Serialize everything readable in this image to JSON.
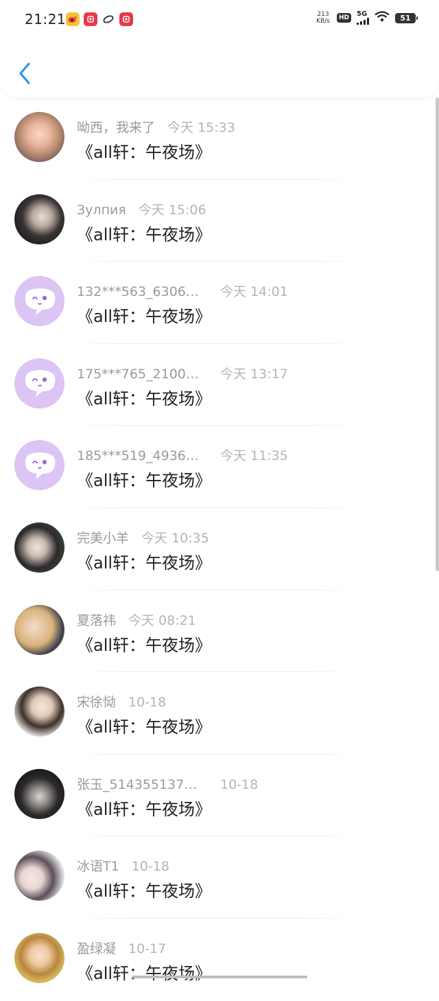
{
  "status_bar": {
    "time": "21:21",
    "net_speed_value": "213",
    "net_speed_unit": "KB/s",
    "hd": "HD",
    "network": "5G",
    "battery": "51"
  },
  "colors": {
    "accent": "#2a9ae8",
    "default_avatar_bg": "#dcc4f4",
    "default_avatar_icon": "#9f6ad6"
  },
  "items": [
    {
      "name": "呦西，我来了",
      "time": "今天 15:33",
      "title": "《all轩：午夜场》",
      "avatar": "photo-avatar"
    },
    {
      "name": "Зулпия",
      "time": "今天 15:06",
      "title": "《all轩：午夜场》",
      "avatar": "photo-avatar"
    },
    {
      "name": "132***563_6306…",
      "time": "今天 14:01",
      "title": "《all轩：午夜场》",
      "avatar": "default-chat-avatar-icon"
    },
    {
      "name": "175***765_2100…",
      "time": "今天 13:17",
      "title": "《all轩：午夜场》",
      "avatar": "default-chat-avatar-icon"
    },
    {
      "name": "185***519_4936…",
      "time": "今天 11:35",
      "title": "《all轩：午夜场》",
      "avatar": "default-chat-avatar-icon"
    },
    {
      "name": "完美小羊",
      "time": "今天 10:35",
      "title": "《all轩：午夜场》",
      "avatar": "photo-avatar"
    },
    {
      "name": "夏落祎",
      "time": "今天 08:21",
      "title": "《all轩：午夜场》",
      "avatar": "photo-avatar"
    },
    {
      "name": "宋徐恸",
      "time": "10-18",
      "title": "《all轩：午夜场》",
      "avatar": "photo-avatar"
    },
    {
      "name": "张玉_514355137…",
      "time": "10-18",
      "title": "《all轩：午夜场》",
      "avatar": "photo-avatar"
    },
    {
      "name": "冰语T1",
      "time": "10-18",
      "title": "《all轩：午夜场》",
      "avatar": "photo-avatar"
    },
    {
      "name": "盈绿凝",
      "time": "10-17",
      "title": "《all轩：午夜场》",
      "avatar": "photo-avatar"
    }
  ]
}
